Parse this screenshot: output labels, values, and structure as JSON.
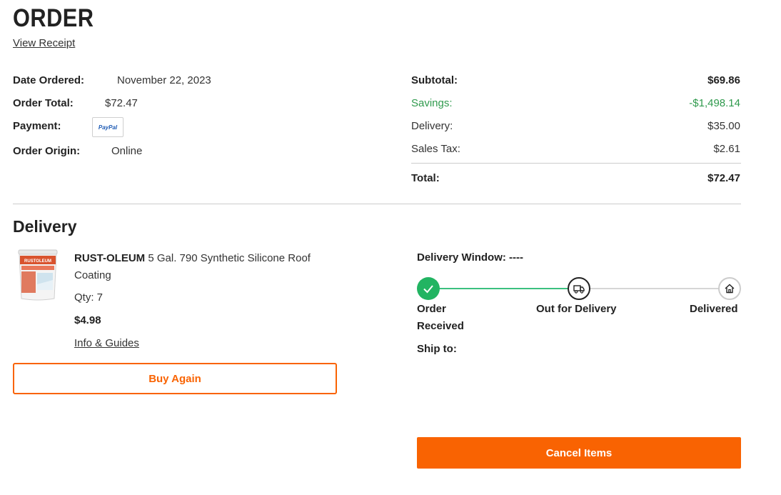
{
  "header": {
    "title": "ORDER",
    "view_receipt": "View Receipt"
  },
  "order_info": {
    "date_label": "Date Ordered:",
    "date_value": "November 22, 2023",
    "total_label": "Order Total:",
    "total_value": "$72.47",
    "payment_label": "Payment:",
    "payment_logo_text": "PayPal",
    "origin_label": "Order Origin:",
    "origin_value": "Online"
  },
  "summary": {
    "subtotal_label": "Subtotal:",
    "subtotal_value": "$69.86",
    "savings_label": "Savings:",
    "savings_value": "-$1,498.14",
    "delivery_label": "Delivery:",
    "delivery_value": "$35.00",
    "tax_label": "Sales Tax:",
    "tax_value": "$2.61",
    "total_label": "Total:",
    "total_value": "$72.47"
  },
  "delivery": {
    "section_title": "Delivery",
    "product": {
      "brand": "RUST-OLEUM",
      "name": " 5 Gal. 790 Synthetic Silicone Roof Coating",
      "image_label": "RUSTOLEUM",
      "qty": "Qty: 7",
      "price": "$4.98",
      "guides_link": "Info & Guides"
    },
    "buy_again": "Buy Again",
    "window_label": "Delivery Window: ----",
    "steps": [
      {
        "label_line1": "Order",
        "label_line2": "Received",
        "icon": "check-icon",
        "status": "complete"
      },
      {
        "label_line1": "Out for Delivery",
        "icon": "truck-icon",
        "status": "current"
      },
      {
        "label_line1": "Delivered",
        "icon": "house-icon",
        "status": "pending"
      }
    ],
    "ship_to_label": "Ship to:",
    "cancel_button": "Cancel Items"
  },
  "colors": {
    "brand_orange": "#f96302",
    "savings_green": "#2f9a4d",
    "progress_green": "#3cc07f",
    "step_complete": "#22b462"
  }
}
